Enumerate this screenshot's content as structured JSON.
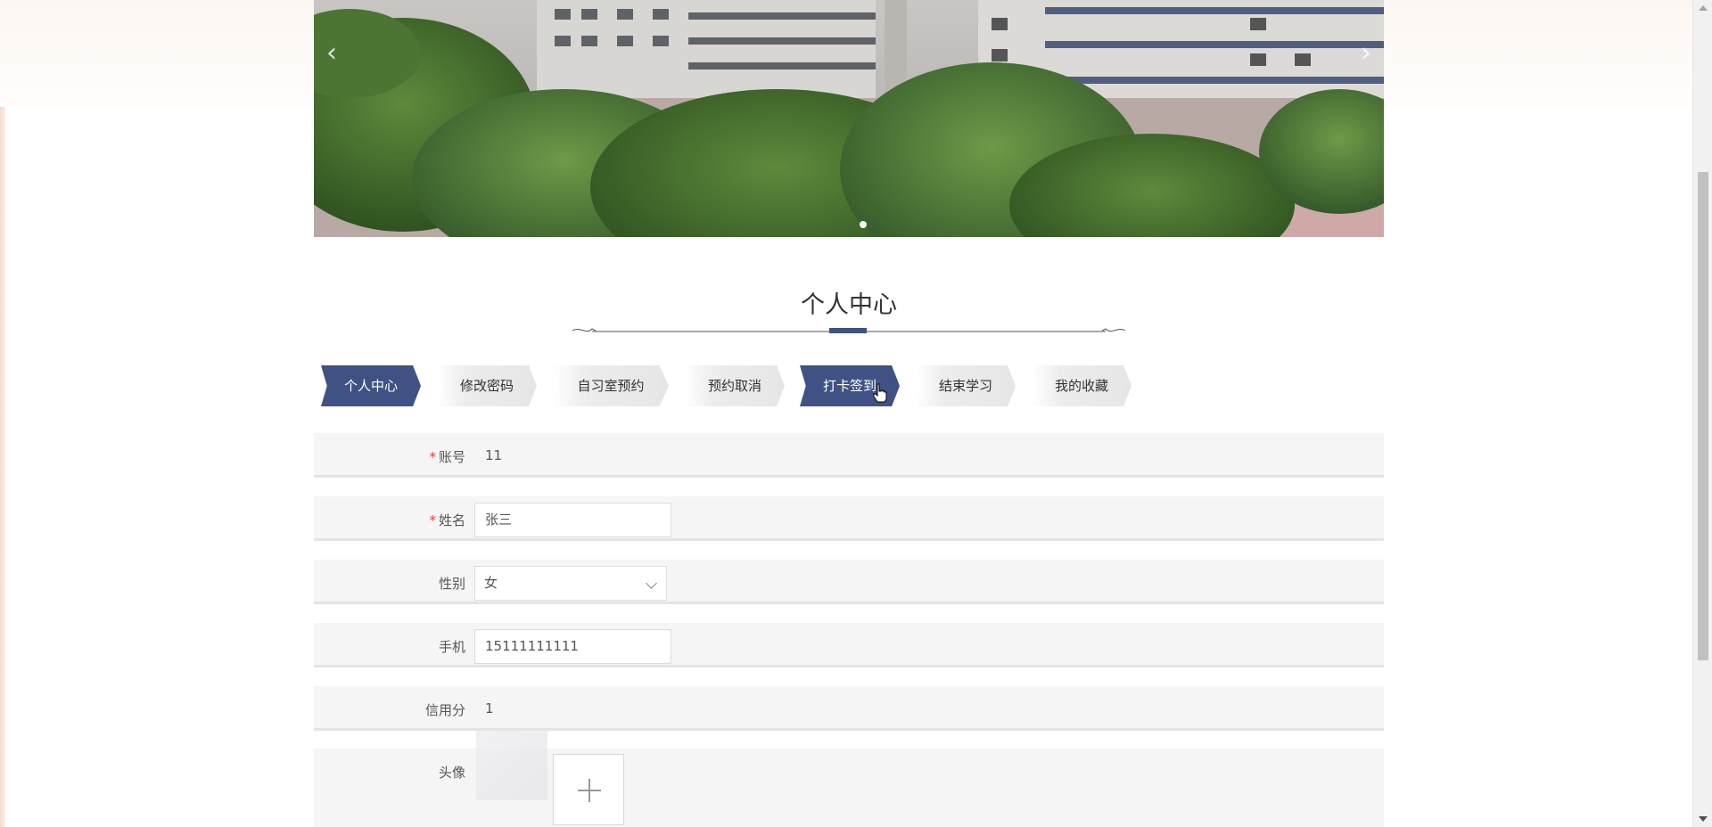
{
  "banner": {
    "prev_label": "‹",
    "next_label": "›"
  },
  "section": {
    "title": "个人中心"
  },
  "tabs": [
    {
      "label": "个人中心",
      "active": true
    },
    {
      "label": "修改密码",
      "active": false
    },
    {
      "label": "自习室预约",
      "active": false
    },
    {
      "label": "预约取消",
      "active": false
    },
    {
      "label": "打卡签到",
      "active": true
    },
    {
      "label": "结束学习",
      "active": false
    },
    {
      "label": "我的收藏",
      "active": false
    }
  ],
  "form": {
    "account": {
      "required_mark": "*",
      "label": "账号",
      "value": "11"
    },
    "name": {
      "required_mark": "*",
      "label": "姓名",
      "value": "张三"
    },
    "gender": {
      "label": "性别",
      "value": "女"
    },
    "phone": {
      "label": "手机",
      "value": "15111111111"
    },
    "credit": {
      "label": "信用分",
      "value": "1"
    },
    "avatar": {
      "label": "头像"
    }
  },
  "colors": {
    "accent": "#3f5283",
    "required": "#e4393c",
    "row_bg": "#f5f5f5"
  }
}
